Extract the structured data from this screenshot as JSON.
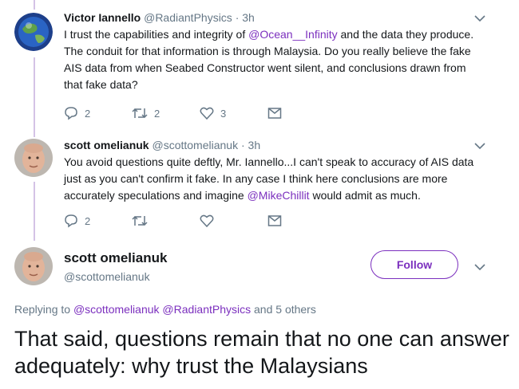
{
  "colors": {
    "accent": "#7b2fbe",
    "thread_line": "#d4c3e6",
    "secondary_text": "#657786"
  },
  "tweets": [
    {
      "name": "Victor Iannello",
      "handle": "@RadiantPhysics",
      "separator": "·",
      "time": "3h",
      "text_parts": [
        "I trust the capabilities and integrity of ",
        "@Ocean__Infinity",
        " and the data they produce. The conduit for that information is through Malaysia. Do you really believe the fake AIS data from when Seabed Constructor went silent, and conclusions drawn from that fake data?"
      ],
      "actions": {
        "reply_icon": "reply-icon",
        "reply_count": "2",
        "retweet_icon": "retweet-icon",
        "retweet_count": "2",
        "like_icon": "like-icon",
        "like_count": "3",
        "dm_icon": "envelope-icon"
      }
    },
    {
      "name": "scott omelianuk",
      "handle": "@scottomelianuk",
      "separator": "·",
      "time": "3h",
      "text_parts": [
        "You avoid questions quite deftly, Mr. Iannello...I can't speak to accuracy of AIS data just as you can't confirm it fake. In any case I think here conclusions are more accurately speculations and imagine ",
        "@MikeChillit",
        " would admit as much."
      ],
      "actions": {
        "reply_icon": "reply-icon",
        "reply_count": "2",
        "retweet_icon": "retweet-icon",
        "retweet_count": "",
        "like_icon": "like-icon",
        "like_count": "",
        "dm_icon": "envelope-icon"
      }
    }
  ],
  "main_tweet": {
    "name": "scott omelianuk",
    "handle": "@scottomelianuk",
    "follow_label": "Follow",
    "replying_prefix": "Replying to ",
    "replying_mentions": "@scottomelianuk @RadiantPhysics",
    "replying_suffix": " and 5 others",
    "text": "That said, questions remain that no one can answer adequately: why trust the Malaysians"
  }
}
